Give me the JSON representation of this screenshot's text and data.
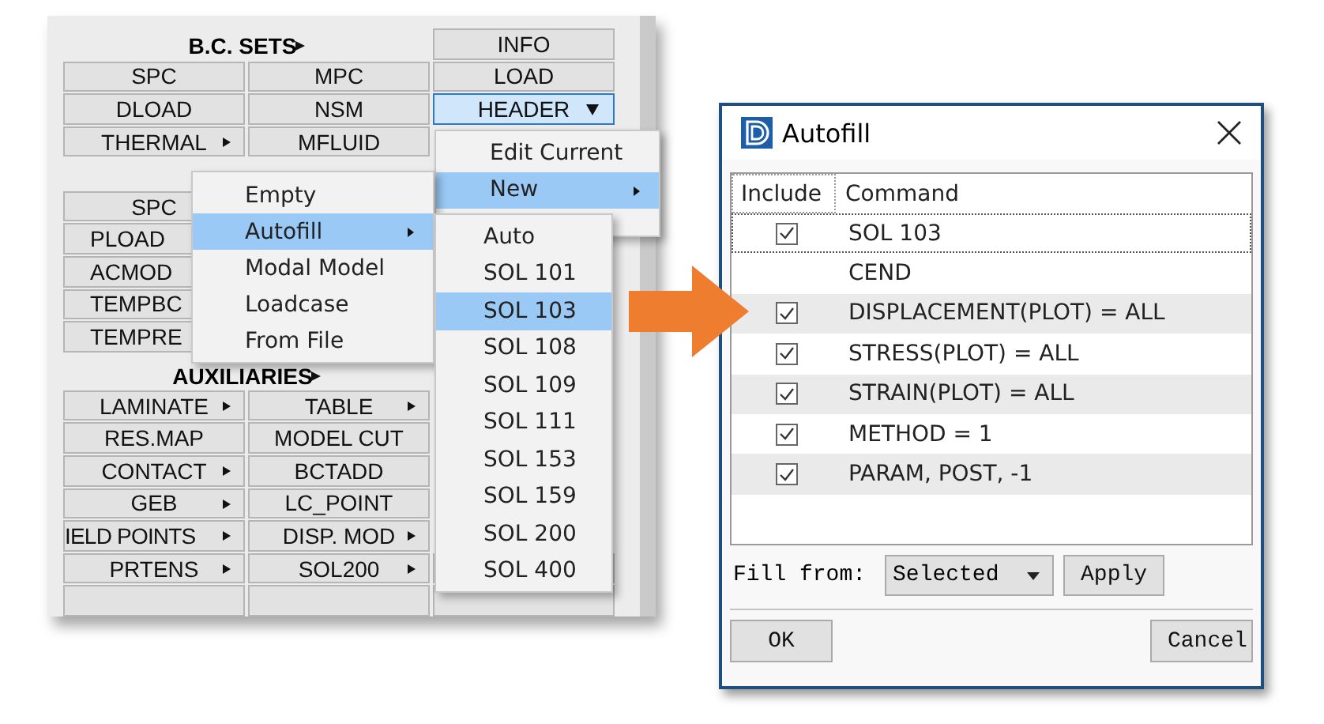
{
  "panel": {
    "sections": [
      {
        "title": "B.C. SETS",
        "title_arrow": true,
        "side_button": {
          "label": "INFO"
        },
        "rows": [
          [
            {
              "kind": "button",
              "label": "SPC",
              "submenu": false
            },
            {
              "kind": "button",
              "label": "MPC",
              "submenu": false
            },
            {
              "kind": "button",
              "label": "LOAD",
              "submenu": false
            }
          ],
          [
            {
              "kind": "button",
              "label": "DLOAD",
              "submenu": false
            },
            {
              "kind": "button",
              "label": "NSM",
              "submenu": false
            },
            {
              "kind": "dropdown",
              "label": "HEADER",
              "active": true
            }
          ],
          [
            {
              "kind": "button",
              "label": "THERMAL",
              "submenu": true
            },
            {
              "kind": "button",
              "label": "MFLUID",
              "submenu": false
            }
          ]
        ]
      },
      {
        "rows": [
          [
            {
              "kind": "button",
              "label": "SPC",
              "submenu": false
            }
          ],
          [
            {
              "kind": "partial",
              "label": "PLOAD"
            }
          ],
          [
            {
              "kind": "partial",
              "label": "ACMOD"
            }
          ],
          [
            {
              "kind": "partial",
              "label": "TEMPBC"
            }
          ],
          [
            {
              "kind": "partial",
              "label": "TEMPRE"
            }
          ]
        ]
      },
      {
        "title": "AUXILIARIES",
        "title_arrow": true,
        "rows": [
          [
            {
              "kind": "button",
              "label": "LAMINATE",
              "submenu": true
            },
            {
              "kind": "button",
              "label": "TABLE",
              "submenu": true
            }
          ],
          [
            {
              "kind": "button",
              "label": "RES.MAP",
              "submenu": false
            },
            {
              "kind": "button",
              "label": "MODEL CUT",
              "submenu": false
            }
          ],
          [
            {
              "kind": "button",
              "label": "CONTACT",
              "submenu": true
            },
            {
              "kind": "button",
              "label": "BCTADD",
              "submenu": false
            }
          ],
          [
            {
              "kind": "button",
              "label": "GEB",
              "submenu": true
            },
            {
              "kind": "button",
              "label": "LC_POINT",
              "submenu": false
            }
          ],
          [
            {
              "kind": "button",
              "label": "IELD POINTS",
              "submenu": true
            },
            {
              "kind": "button",
              "label": "DISP. MOD",
              "submenu": true
            }
          ],
          [
            {
              "kind": "button",
              "label": "PRTENS",
              "submenu": true
            },
            {
              "kind": "button",
              "label": "SOL200",
              "submenu": true
            },
            {
              "kind": "blank"
            }
          ],
          [
            {
              "kind": "blank"
            },
            {
              "kind": "blank"
            },
            {
              "kind": "blank"
            }
          ]
        ]
      }
    ]
  },
  "menus": [
    {
      "items": [
        {
          "label": "Edit Current",
          "selected": false,
          "submenu": false
        },
        {
          "label": "New",
          "selected": true,
          "submenu": true
        }
      ]
    },
    {
      "items": [
        {
          "label": "Empty",
          "selected": false,
          "submenu": false
        },
        {
          "label": "Autofill",
          "selected": true,
          "submenu": true
        },
        {
          "label": "Modal Model",
          "selected": false,
          "submenu": false
        },
        {
          "label": "Loadcase",
          "selected": false,
          "submenu": false
        },
        {
          "label": "From File",
          "selected": false,
          "submenu": false
        }
      ]
    },
    {
      "items": [
        {
          "label": "Auto",
          "selected": false,
          "submenu": false
        },
        {
          "label": "SOL 101",
          "selected": false,
          "submenu": false
        },
        {
          "label": "SOL 103",
          "selected": true,
          "submenu": false
        },
        {
          "label": "SOL 108",
          "selected": false,
          "submenu": false
        },
        {
          "label": "SOL 109",
          "selected": false,
          "submenu": false
        },
        {
          "label": "SOL 111",
          "selected": false,
          "submenu": false
        },
        {
          "label": "SOL 153",
          "selected": false,
          "submenu": false
        },
        {
          "label": "SOL 159",
          "selected": false,
          "submenu": false
        },
        {
          "label": "SOL 200",
          "selected": false,
          "submenu": false
        },
        {
          "label": "SOL 400",
          "selected": false,
          "submenu": false
        }
      ]
    }
  ],
  "dialog": {
    "title": "Autofill",
    "table": {
      "columns": [
        "Include",
        "Command"
      ],
      "rows": [
        {
          "kind": "check",
          "checked": true,
          "selected": true,
          "command": "SOL 103"
        },
        {
          "kind": "plain",
          "selected": false,
          "command": "CEND"
        },
        {
          "kind": "check",
          "checked": true,
          "selected": false,
          "command": "DISPLACEMENT(PLOT) = ALL"
        },
        {
          "kind": "check",
          "checked": true,
          "selected": false,
          "command": "STRESS(PLOT) = ALL"
        },
        {
          "kind": "check",
          "checked": true,
          "selected": false,
          "command": "STRAIN(PLOT) = ALL"
        },
        {
          "kind": "check",
          "checked": true,
          "selected": false,
          "command": "METHOD = 1"
        },
        {
          "kind": "check",
          "checked": true,
          "selected": false,
          "command": "PARAM, POST, -1"
        }
      ]
    },
    "fill_from": {
      "label": "Fill from:",
      "value": "Selected",
      "button": "Apply"
    },
    "buttons": [
      "OK",
      "Cancel"
    ]
  }
}
